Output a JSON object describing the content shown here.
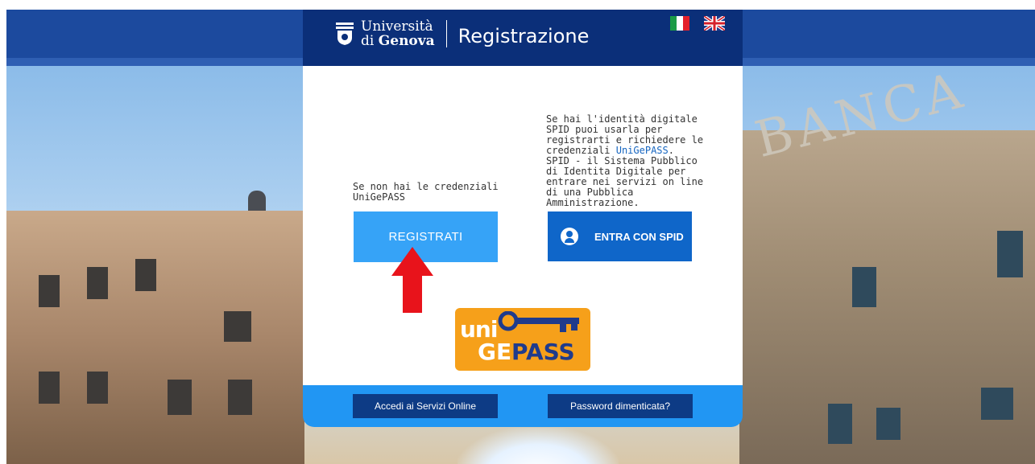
{
  "header": {
    "logo_line1": "Università",
    "logo_line2_prefix": "di ",
    "logo_line2_bold": "Genova",
    "title": "Registrazione"
  },
  "languages": [
    "it-flag-icon",
    "uk-flag-icon"
  ],
  "left": {
    "text": "Se non hai le credenziali UniGePASS",
    "button": "REGISTRATI"
  },
  "right": {
    "text_1": "Se hai l'identità digitale SPID puoi usarla per registrarti e richiedere le credenziali",
    "link": "UniGePASS",
    "text_2": ".",
    "text_3": "SPID - il Sistema Pubblico di Identita Digitale per entrare nei servizi on line di una Pubblica Amministrazione.",
    "button": "ENTRA CON SPID"
  },
  "brand": {
    "uni": "uni",
    "ge": "GE",
    "pass": "PASS"
  },
  "footer": {
    "services_button": "Accedi ai Servizi Online",
    "password_button": "Password dimenticata?"
  },
  "colors": {
    "header_blue": "#0b2f79",
    "primary_button": "#36a3f7",
    "spid_button": "#0f66c9",
    "footer_bar": "#2196f3",
    "footer_button": "#0d3b85",
    "arrow_red": "#e8131b",
    "unigepass_orange": "#f6a01a"
  }
}
